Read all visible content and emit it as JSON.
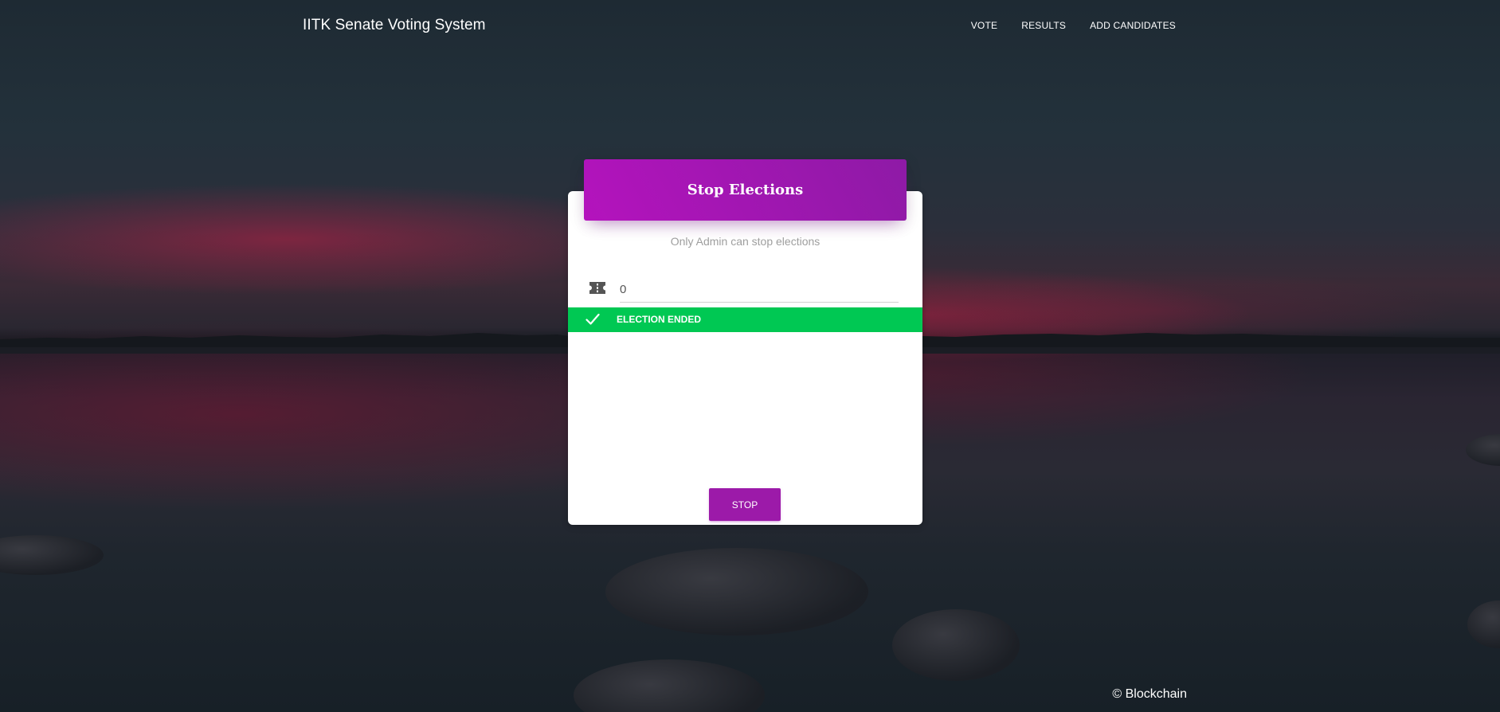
{
  "nav": {
    "brand": "IITK Senate Voting System",
    "links": [
      {
        "label": "VOTE"
      },
      {
        "label": "RESULTS"
      },
      {
        "label": "ADD CANDIDATES"
      }
    ]
  },
  "card": {
    "title": "Stop Elections",
    "subtitle": "Only Admin can stop elections",
    "input": {
      "value": "0",
      "icon": "ticket-icon"
    },
    "alert": {
      "text": "ELECTION ENDED",
      "icon": "check-icon"
    },
    "stop_button": "STOP"
  },
  "footer": {
    "text": "© Blockchain"
  },
  "colors": {
    "header_gradient_start": "#b413bd",
    "header_gradient_end": "#8e1aa6",
    "alert_green": "#00c853",
    "button_purple": "#9c1aa9"
  }
}
